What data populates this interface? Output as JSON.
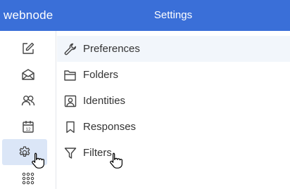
{
  "app": {
    "logo": "webnode",
    "title": "Settings"
  },
  "sidebar": {
    "items": [
      {
        "name": "compose",
        "icon": "compose-icon"
      },
      {
        "name": "mail",
        "icon": "mail-icon"
      },
      {
        "name": "contacts",
        "icon": "contacts-icon"
      },
      {
        "name": "calendar",
        "icon": "calendar-icon",
        "day": "12"
      },
      {
        "name": "settings",
        "icon": "gear-icon",
        "selected": true
      },
      {
        "name": "apps",
        "icon": "apps-grid-icon"
      }
    ]
  },
  "settings": {
    "sections": [
      {
        "label": "Preferences",
        "icon": "wrench-icon",
        "active": true
      },
      {
        "label": "Folders",
        "icon": "folder-icon"
      },
      {
        "label": "Identities",
        "icon": "identity-card-icon"
      },
      {
        "label": "Responses",
        "icon": "bookmark-icon"
      },
      {
        "label": "Filters",
        "icon": "filter-icon"
      }
    ]
  },
  "colors": {
    "header": "#3a6fd8",
    "selected_nav": "#dbe6f7",
    "active_row": "#f2f6fb",
    "icon": "#444444"
  }
}
